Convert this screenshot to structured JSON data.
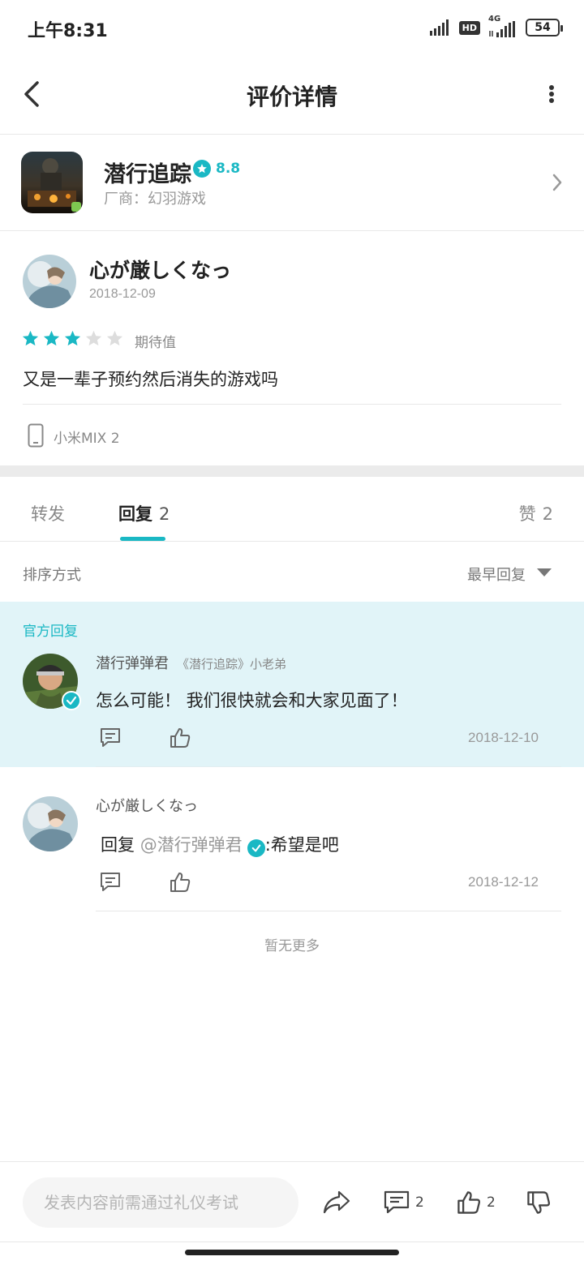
{
  "status_bar": {
    "time": "上午8:31",
    "hd": "HD",
    "network": "4G",
    "battery": "54"
  },
  "nav": {
    "title": "评价详情"
  },
  "app": {
    "name": "潜行追踪",
    "rating": "8.8",
    "vendor": "厂商：幻羽游戏"
  },
  "review": {
    "author": "心が厳しくなっ",
    "date": "2018-12-09",
    "stars": 3,
    "max_stars": 5,
    "star_label": "期待值",
    "text": "又是一辈子预约然后消失的游戏吗",
    "device": "小米MIX 2"
  },
  "tabs": {
    "forward": "转发",
    "replies": "回复",
    "replies_count": "2",
    "likes": "赞",
    "likes_count": "2"
  },
  "sort": {
    "label": "排序方式",
    "value": "最早回复"
  },
  "official_reply": {
    "section_label": "官方回复",
    "name": "潜行弹弹君",
    "tag": "《潜行追踪》小老弟",
    "text": "怎么可能！ 我们很快就会和大家见面了！",
    "date": "2018-12-10"
  },
  "reply2": {
    "name": "心が厳しくなっ",
    "prefix": "回复 ",
    "mention": "@潜行弹弹君",
    "text": ":希望是吧",
    "date": "2018-12-12"
  },
  "no_more": "暂无更多",
  "bottom_bar": {
    "input_placeholder": "发表内容前需通过礼仪考试",
    "comment_count": "2",
    "like_count": "2"
  },
  "colors": {
    "accent": "#1ab8c4",
    "official_bg": "#e1f4f8",
    "star_empty": "#dddddd"
  }
}
